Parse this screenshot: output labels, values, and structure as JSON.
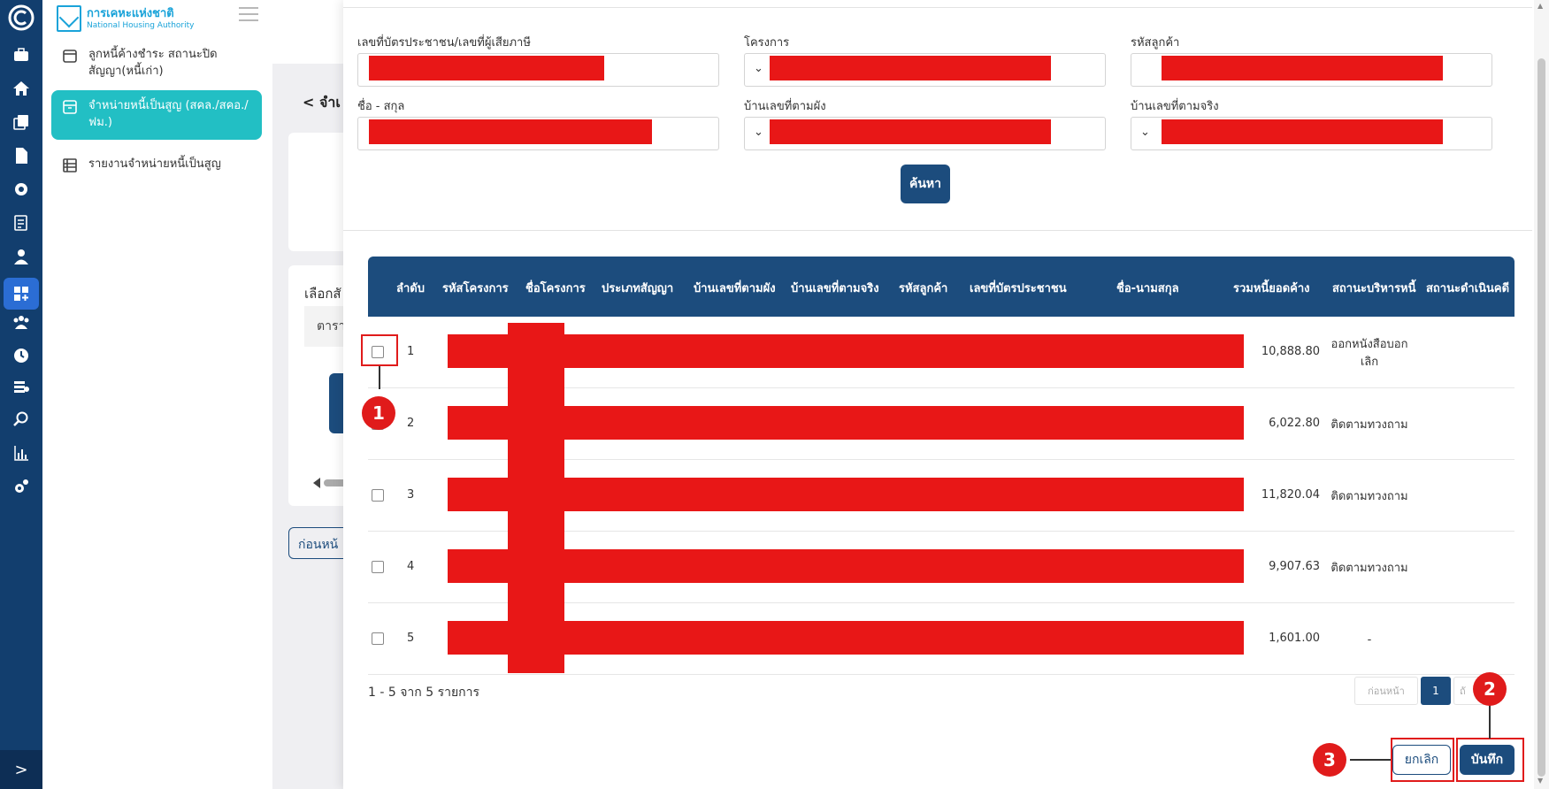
{
  "rail": {
    "icons": [
      "brand-c-icon",
      "briefcase-icon",
      "home-icon",
      "copy-icon",
      "document-icon",
      "gear-badge-icon",
      "checklist-icon",
      "user-icon",
      "dashboard-icon",
      "people-icon",
      "clock-gear-icon",
      "server-gear-icon",
      "search-icon",
      "bar-chart-icon",
      "gears-icon"
    ],
    "expand_label": ">"
  },
  "sidebar": {
    "brand_th": "การเคหะแห่งชาติ",
    "brand_en": "National Housing Authority",
    "items": [
      {
        "label": "ลูกหนี้ค้างชำระ สถานะปิดสัญญา(หนี้เก่า)",
        "icon": "calendar-icon",
        "active": false
      },
      {
        "label": "จำหน่ายหนี้เป็นสูญ (สคล./สคอ./ฟม.)",
        "icon": "archive-icon",
        "active": true
      },
      {
        "label": "รายงานจำหน่ายหนี้เป็นสูญ",
        "icon": "table-icon",
        "active": false
      }
    ]
  },
  "page": {
    "header": "< จำเ",
    "select_label": "เลือกสั",
    "gray_text": "ตารา",
    "prev_button": "ก่อนหน้"
  },
  "modal": {
    "fields": [
      {
        "label": "เลขที่บัตรประชาชน/เลขที่ผู้เสียภาษี",
        "dropdown": false
      },
      {
        "label": "โครงการ",
        "dropdown": true
      },
      {
        "label": "รหัสลูกค้า",
        "dropdown": false
      },
      {
        "label": "ชื่อ - สกุล",
        "dropdown": false
      },
      {
        "label": "บ้านเลขที่ตามผัง",
        "dropdown": true
      },
      {
        "label": "บ้านเลขที่ตามจริง",
        "dropdown": true
      }
    ],
    "search_button": "ค้นหา",
    "table": {
      "headers": [
        "ลำดับ",
        "รหัสโครงการ",
        "ชื่อโครงการ",
        "ประเภทสัญญา",
        "บ้านเลขที่ตามผัง",
        "บ้านเลขที่ตามจริง",
        "รหัสลูกค้า",
        "เลขที่บัตรประชาชน",
        "ชื่อ-นามสกุล",
        "รวมหนี้ยอดค้าง",
        "สถานะบริหารหนี้",
        "สถานะดำเนินคดี"
      ],
      "rows": [
        {
          "no": "1",
          "amount": "10,888.80",
          "status": "ออกหนังสือบอกเลิก"
        },
        {
          "no": "2",
          "amount": "6,022.80",
          "status": "ติดตามทวงถาม"
        },
        {
          "no": "3",
          "amount": "11,820.04",
          "status": "ติดตามทวงถาม"
        },
        {
          "no": "4",
          "amount": "9,907.63",
          "status": "ติดตามทวงถาม"
        },
        {
          "no": "5",
          "amount": "1,601.00",
          "status": "-"
        }
      ]
    },
    "pagination": {
      "summary": "1 - 5 จาก 5 รายการ",
      "prev": "ก่อนหน้า",
      "current": "1",
      "next": "ถั"
    },
    "cancel_button": "ยกเลิก",
    "save_button": "บันทึก"
  },
  "annotations": [
    "1",
    "2",
    "3"
  ],
  "colors": {
    "rail": "#123e6e",
    "active_nav": "#22bfc4",
    "primary": "#1c4c7d",
    "redaction": "#e81717",
    "annotation": "#e01b1b"
  }
}
